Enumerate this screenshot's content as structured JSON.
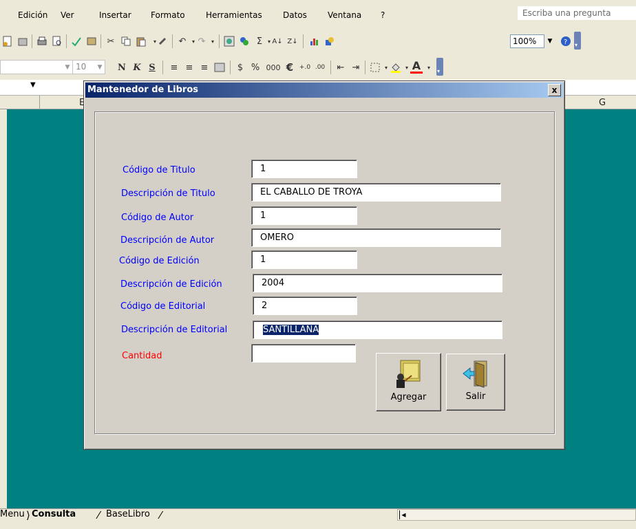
{
  "menu": {
    "items": [
      "Edición",
      "Ver",
      "Insertar",
      "Formato",
      "Herramientas",
      "Datos",
      "Ventana",
      "?"
    ],
    "ask_placeholder": "Escriba una pregunta"
  },
  "toolbar": {
    "zoom": "100%",
    "font_size": "10",
    "bold": "N",
    "italic": "K",
    "underline": "S",
    "currency": "$",
    "percent": "%",
    "thousands": "000",
    "euro": "€"
  },
  "columns": {
    "left": "E",
    "right": "G"
  },
  "sheet_tabs": {
    "tabs": [
      "Menu",
      "Consulta",
      "BaseLibro"
    ],
    "active": "Consulta"
  },
  "dialog": {
    "title": "Mantenedor de Libros",
    "close": "x",
    "fields": [
      {
        "label": "Código de Titulo",
        "value": "1"
      },
      {
        "label": "Descripción de Titulo",
        "value": "EL CABALLO DE TROYA"
      },
      {
        "label": "Código de Autor",
        "value": "1"
      },
      {
        "label": "Descripción de Autor",
        "value": "OMERO"
      },
      {
        "label": "Código de Edición",
        "value": "1"
      },
      {
        "label": "Descripción de Edición",
        "value": "2004"
      },
      {
        "label": "Código de Editorial",
        "value": "2"
      },
      {
        "label": "Descripción de Editorial",
        "value": "SANTILLANA"
      },
      {
        "label": "Cantidad",
        "value": ""
      }
    ],
    "buttons": {
      "add": "Agregar",
      "exit": "Salir"
    }
  },
  "colors": {
    "grid_bg": "#008080",
    "label_blue": "#0000ff",
    "label_red": "#ff0000",
    "title_start": "#0a246a",
    "title_end": "#a6caf0"
  }
}
